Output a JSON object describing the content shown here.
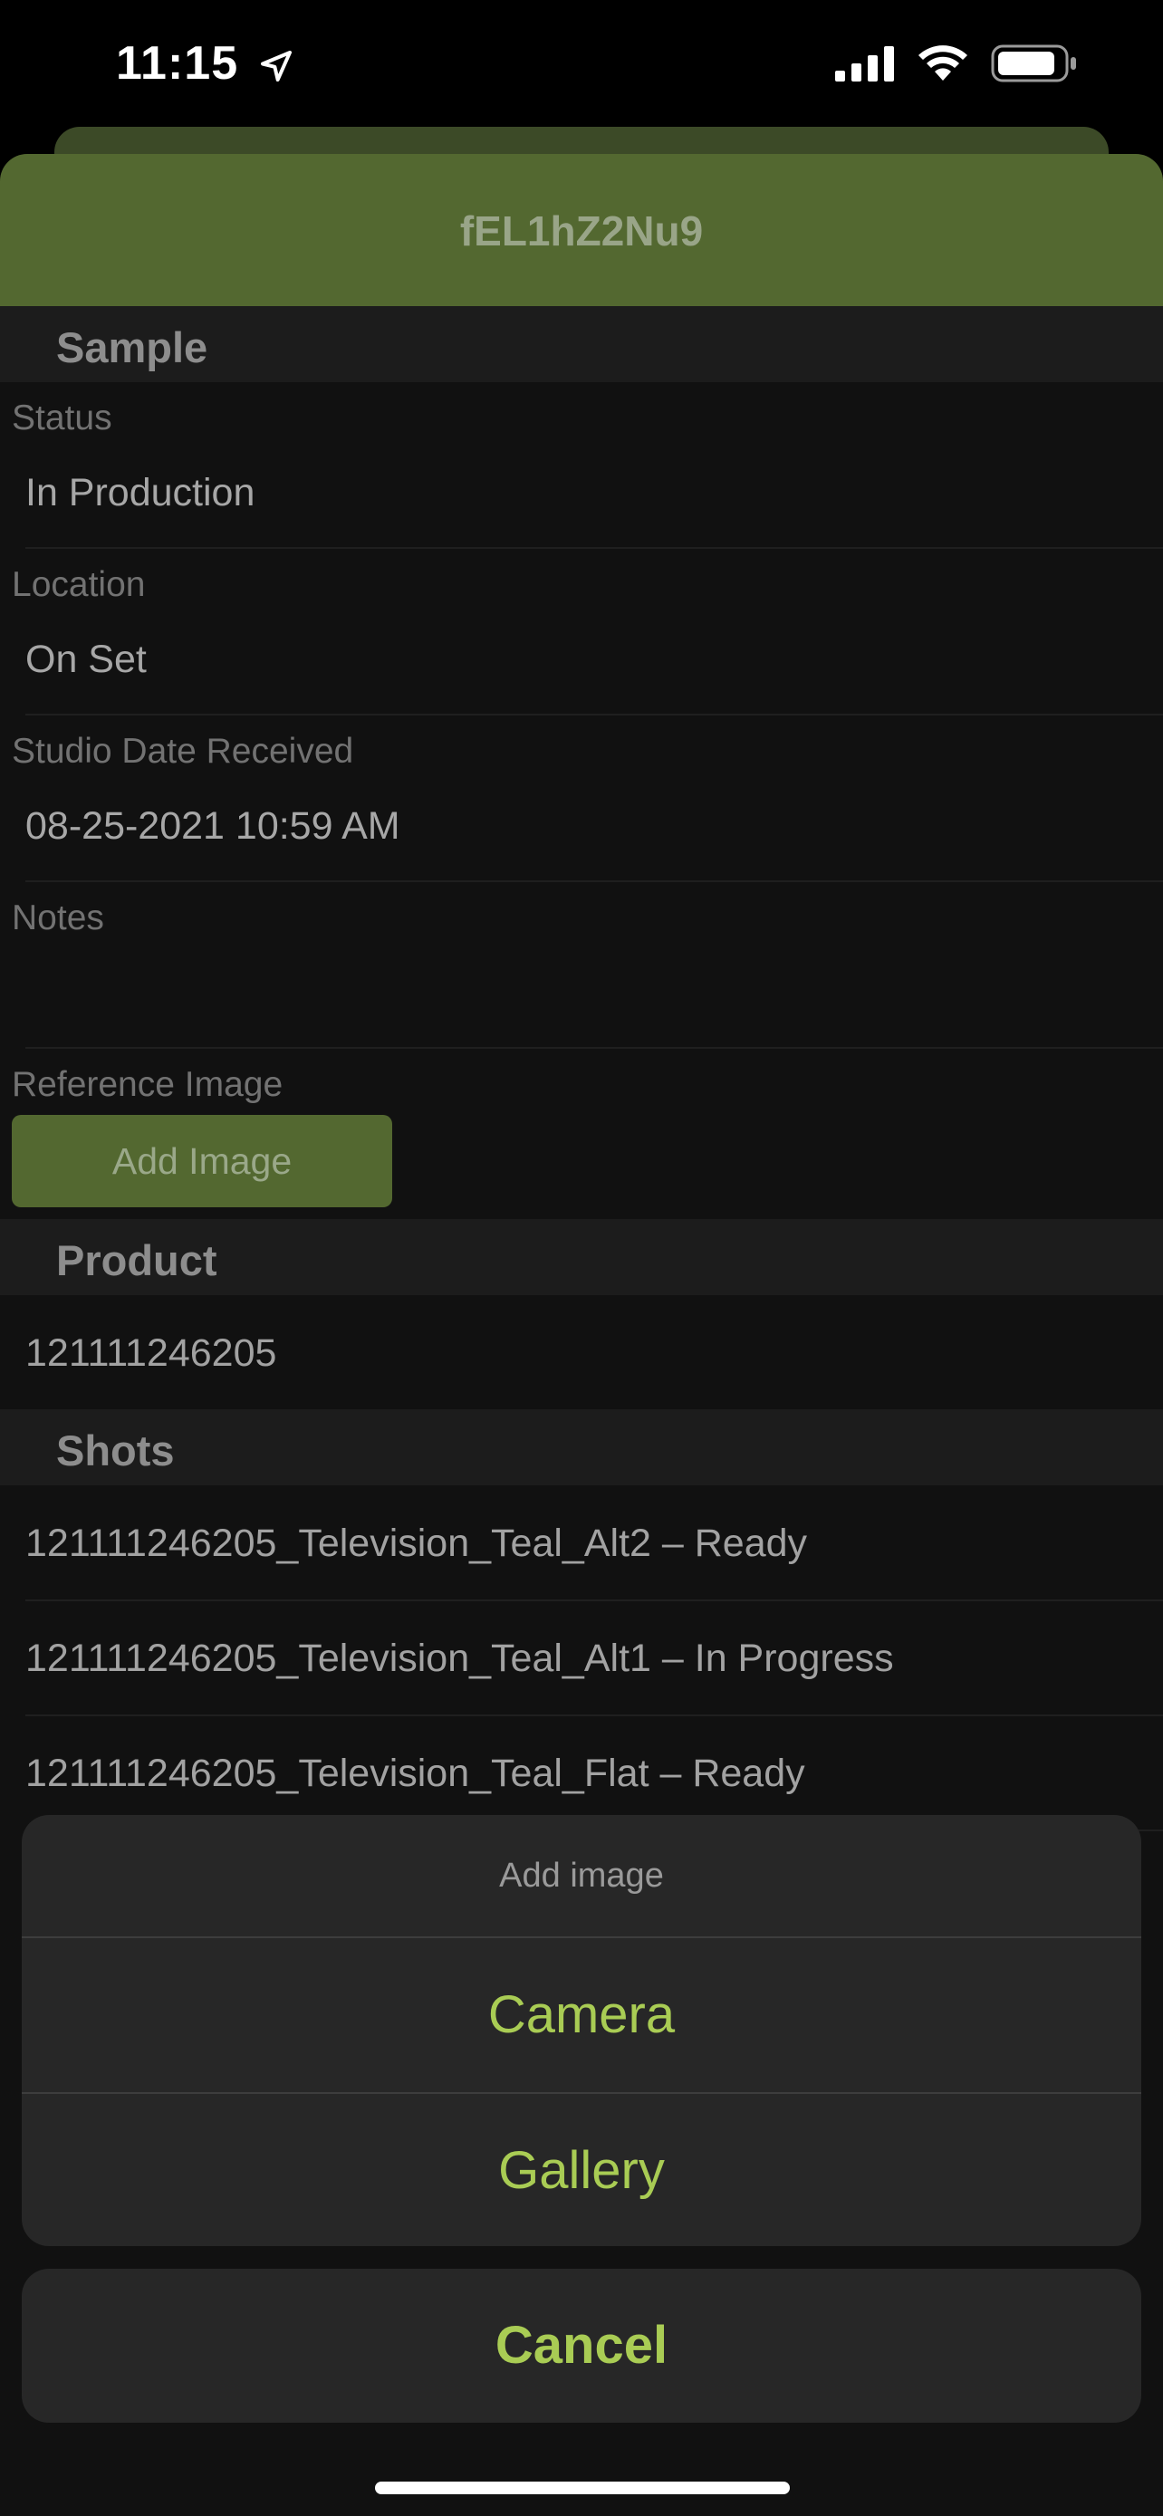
{
  "status_bar": {
    "time": "11:15"
  },
  "header": {
    "title": "fEL1hZ2Nu9"
  },
  "sample": {
    "section_title": "Sample",
    "status_label": "Status",
    "status_value": "In Production",
    "location_label": "Location",
    "location_value": "On Set",
    "date_label": "Studio Date Received",
    "date_value": "08-25-2021 10:59 AM",
    "notes_label": "Notes",
    "notes_value": "",
    "reference_label": "Reference Image",
    "add_image_button": "Add Image"
  },
  "product": {
    "section_title": "Product",
    "value": "121111246205"
  },
  "shots": {
    "section_title": "Shots",
    "items": [
      "121111246205_Television_Teal_Alt2 – Ready",
      "121111246205_Television_Teal_Alt1 – In Progress",
      "121111246205_Television_Teal_Flat – Ready"
    ]
  },
  "action_sheet": {
    "title": "Add image",
    "options": [
      "Camera",
      "Gallery"
    ],
    "cancel": "Cancel"
  },
  "colors": {
    "accent_green": "#536830",
    "action_text": "#a9cc54"
  }
}
